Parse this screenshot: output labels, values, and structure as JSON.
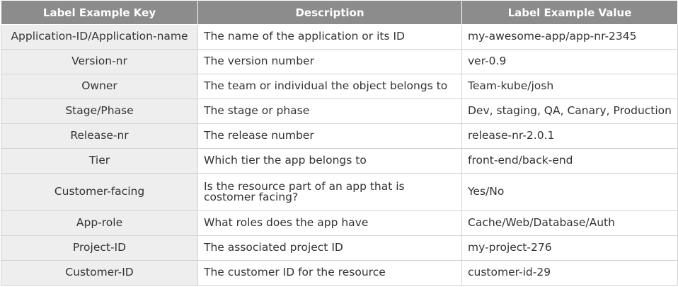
{
  "header": {
    "key": "Label Example Key",
    "description": "Description",
    "value": "Label Example Value"
  },
  "rows": [
    {
      "key": "Application-ID/Application-name",
      "description": "The name of the application or its ID",
      "value": "my-awesome-app/app-nr-2345"
    },
    {
      "key": "Version-nr",
      "description": "The version number",
      "value": "ver-0.9"
    },
    {
      "key": "Owner",
      "description": "The team or individual the object belongs to",
      "value": "Team-kube/josh"
    },
    {
      "key": "Stage/Phase",
      "description": "The stage or phase",
      "value": "Dev, staging, QA, Canary, Production"
    },
    {
      "key": "Release-nr",
      "description": "The release number",
      "value": "release-nr-2.0.1"
    },
    {
      "key": "Tier",
      "description": "Which tier the app belongs to",
      "value": "front-end/back-end"
    },
    {
      "key": "Customer-facing",
      "description": "Is the resource part of an app that is costomer facing?",
      "value": "Yes/No"
    },
    {
      "key": "App-role",
      "description": "What roles does the app have",
      "value": "Cache/Web/Database/Auth"
    },
    {
      "key": "Project-ID",
      "description": "The associated project ID",
      "value": "my-project-276"
    },
    {
      "key": "Customer-ID",
      "description": "The customer ID for the resource",
      "value": "customer-id-29"
    }
  ]
}
